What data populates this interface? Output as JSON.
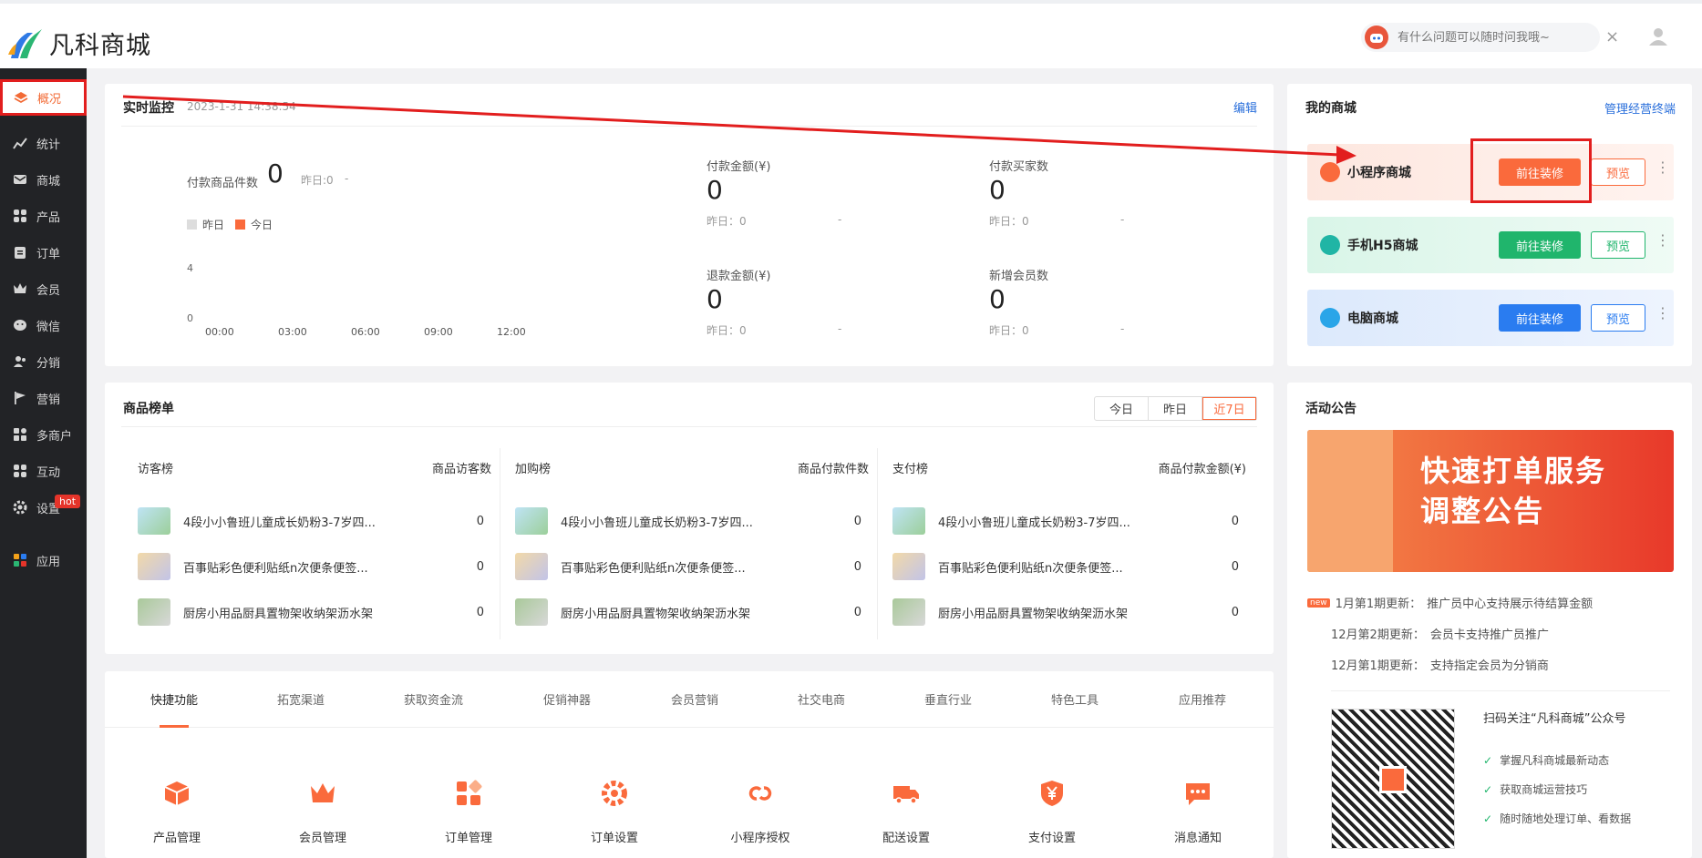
{
  "app": {
    "logo_text": "凡科商城"
  },
  "header": {
    "ai_placeholder": "有什么问题可以随时问我哦~",
    "close": "×"
  },
  "sidebar": {
    "items": [
      {
        "label": "概况",
        "icon": "layers-icon",
        "active": true
      },
      {
        "label": "统计",
        "icon": "chart-icon"
      },
      {
        "label": "商城",
        "icon": "mail-icon"
      },
      {
        "label": "产品",
        "icon": "grid-icon"
      },
      {
        "label": "订单",
        "icon": "clipboard-icon"
      },
      {
        "label": "会员",
        "icon": "crown-icon"
      },
      {
        "label": "微信",
        "icon": "wechat-icon"
      },
      {
        "label": "分销",
        "icon": "users-icon"
      },
      {
        "label": "营销",
        "icon": "flag-icon"
      },
      {
        "label": "多商户",
        "icon": "store-icon"
      },
      {
        "label": "互动",
        "icon": "interaction-icon"
      },
      {
        "label": "设置",
        "icon": "gear-icon"
      },
      {
        "label": "应用",
        "icon": "apps-icon"
      }
    ],
    "hot_badge": "hot"
  },
  "monitor": {
    "title": "实时监控",
    "timestamp": "2023-1-31 14:38:54",
    "edit": "编辑",
    "paid_items_label": "付款商品件数",
    "paid_items_value": "0",
    "paid_items_yesterday": "昨日:0",
    "dash": "-",
    "legend_yesterday": "昨日",
    "legend_today": "今日",
    "y_ticks": [
      "4",
      "0"
    ],
    "x_ticks": [
      "00:00",
      "03:00",
      "06:00",
      "09:00",
      "12:00"
    ],
    "kpis": [
      {
        "label": "付款金额(¥)",
        "value": "0",
        "yesterday": "昨日：0",
        "dash": "-"
      },
      {
        "label": "付款买家数",
        "value": "0",
        "yesterday": "昨日：0",
        "dash": "-"
      },
      {
        "label": "退款金额(¥)",
        "value": "0",
        "yesterday": "昨日：0",
        "dash": "-"
      },
      {
        "label": "新增会员数",
        "value": "0",
        "yesterday": "昨日：0",
        "dash": "-"
      }
    ]
  },
  "myshop": {
    "title": "我的商城",
    "manage_link": "管理经营终端",
    "shops": [
      {
        "name": "小程序商城",
        "go": "前往装修",
        "preview": "预览",
        "accent": "#fa6a3c"
      },
      {
        "name": "手机H5商城",
        "go": "前往装修",
        "preview": "预览",
        "accent": "#20b56c"
      },
      {
        "name": "电脑商城",
        "go": "前往装修",
        "preview": "预览",
        "accent": "#2a7cf0"
      }
    ],
    "more": "⋮"
  },
  "ranking": {
    "title": "商品榜单",
    "tabs": [
      "今日",
      "昨日",
      "近7日"
    ],
    "active_tab": "近7日",
    "columns": [
      {
        "title": "访客榜",
        "metric": "商品访客数",
        "items": [
          {
            "name": "4段小小鲁班儿童成长奶粉3-7岁四...",
            "value": "0"
          },
          {
            "name": "百事贴彩色便利贴纸n次便条便签...",
            "value": "0"
          },
          {
            "name": "厨房小用品厨具置物架收纳架沥水架",
            "value": "0"
          }
        ]
      },
      {
        "title": "加购榜",
        "metric": "商品付款件数",
        "items": [
          {
            "name": "4段小小鲁班儿童成长奶粉3-7岁四...",
            "value": "0"
          },
          {
            "name": "百事贴彩色便利贴纸n次便条便签...",
            "value": "0"
          },
          {
            "name": "厨房小用品厨具置物架收纳架沥水架",
            "value": "0"
          }
        ]
      },
      {
        "title": "支付榜",
        "metric": "商品付款金额(¥)",
        "items": [
          {
            "name": "4段小小鲁班儿童成长奶粉3-7岁四...",
            "value": "0"
          },
          {
            "name": "百事贴彩色便利贴纸n次便条便签...",
            "value": "0"
          },
          {
            "name": "厨房小用品厨具置物架收纳架沥水架",
            "value": "0"
          }
        ]
      }
    ]
  },
  "announcements": {
    "title": "活动公告",
    "banner_line1": "快速打单服务",
    "banner_line2": "调整公告",
    "new_badge": "new",
    "items": [
      {
        "label": "1月第1期更新：",
        "text": "推广员中心支持展示待结算金额"
      },
      {
        "label": "12月第2期更新：",
        "text": "会员卡支持推广员推广"
      },
      {
        "label": "12月第1期更新：",
        "text": "支持指定会员为分销商"
      }
    ],
    "qr_title": "扫码关注“凡科商城”公众号",
    "qr_points": [
      "掌握凡科商城最新动态",
      "获取商城运营技巧",
      "随时随地处理订单、看数据"
    ]
  },
  "quick": {
    "tabs": [
      "快捷功能",
      "拓宽渠道",
      "获取资金流",
      "促销神器",
      "会员营销",
      "社交电商",
      "垂直行业",
      "特色工具",
      "应用推荐"
    ],
    "items": [
      {
        "label": "产品管理",
        "icon": "cube-icon"
      },
      {
        "label": "会员管理",
        "icon": "crown-icon"
      },
      {
        "label": "订单管理",
        "icon": "blocks-icon"
      },
      {
        "label": "订单设置",
        "icon": "gear-icon"
      },
      {
        "label": "小程序授权",
        "icon": "link-icon"
      },
      {
        "label": "配送设置",
        "icon": "truck-icon"
      },
      {
        "label": "支付设置",
        "icon": "shield-yen-icon"
      },
      {
        "label": "消息通知",
        "icon": "message-icon"
      }
    ]
  },
  "colors": {
    "brand": "#fa6a3c",
    "blue": "#2a6fdb",
    "green": "#20b56c",
    "annotation": "#e21e1e"
  }
}
